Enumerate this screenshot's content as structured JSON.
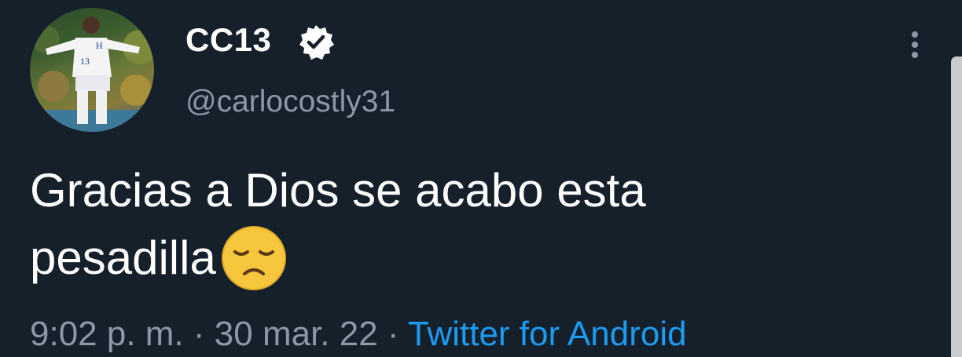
{
  "tweet": {
    "display_name": "CC13",
    "handle": "@carlocostly31",
    "text_line1": "Gracias a Dios se acabo esta",
    "text_line2": "pesadilla",
    "emoji": "disappointed-face",
    "time": "9:02 p. m.",
    "separator": " · ",
    "date": "30 mar. 22",
    "source": "Twitter for Android"
  },
  "colors": {
    "background": "#15202b",
    "text": "#ffffff",
    "secondary": "#8b98a5",
    "link": "#1d9bf0"
  }
}
